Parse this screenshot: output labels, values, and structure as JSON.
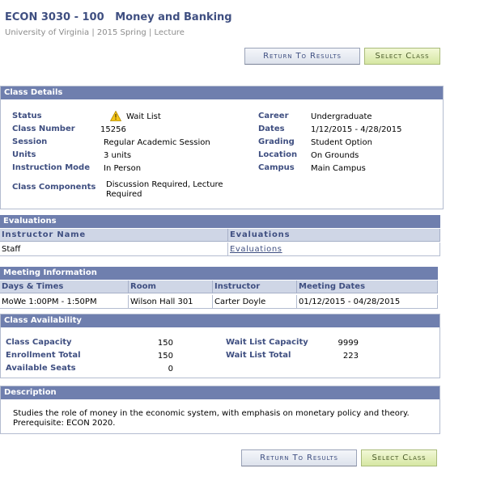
{
  "header": {
    "title": "ECON 3030 - 100   Money and Banking",
    "subtitle": "University of Virginia | 2015 Spring | Lecture"
  },
  "buttons": {
    "return_label": "Return To Results",
    "select_label": "Select Class"
  },
  "class_details": {
    "heading": "Class Details",
    "status_label": "Status",
    "status_value": "Wait List",
    "class_number_label": "Class Number",
    "class_number_value": "15256",
    "session_label": "Session",
    "session_value": "Regular Academic Session",
    "units_label": "Units",
    "units_value": "3 units",
    "instruction_mode_label": "Instruction Mode",
    "instruction_mode_value": "In Person",
    "components_label": "Class Components",
    "components_value_1": "Discussion Required, Lecture",
    "components_value_2": "Required",
    "career_label": "Career",
    "career_value": "Undergraduate",
    "dates_label": "Dates",
    "dates_value": "1/12/2015 - 4/28/2015",
    "grading_label": "Grading",
    "grading_value": "Student Option",
    "location_label": "Location",
    "location_value": "On Grounds",
    "campus_label": "Campus",
    "campus_value": "Main Campus",
    "status_icon": "warning-triangle-icon"
  },
  "evaluations": {
    "heading": "Evaluations",
    "columns": [
      "Instructor Name",
      "Evaluations"
    ],
    "row": {
      "instructor": "Staff",
      "link": "Evaluations"
    }
  },
  "meeting": {
    "heading": "Meeting Information",
    "columns": [
      "Days & Times",
      "Room",
      "Instructor",
      "Meeting Dates"
    ],
    "row": [
      "MoWe 1:00PM - 1:50PM",
      "Wilson Hall 301",
      "Carter Doyle",
      "01/12/2015 - 04/28/2015"
    ]
  },
  "availability": {
    "heading": "Class Availability",
    "capacity_label": "Class Capacity",
    "capacity_value": "150",
    "enrollment_label": "Enrollment Total",
    "enrollment_value": "150",
    "seats_label": "Available Seats",
    "seats_value": "0",
    "wl_capacity_label": "Wait List Capacity",
    "wl_capacity_value": "9999",
    "wl_total_label": "Wait List Total",
    "wl_total_value": "223"
  },
  "description": {
    "heading": "Description",
    "line1": "Studies the role of money in the economic system, with emphasis on monetary policy and theory.",
    "line2": "Prerequisite: ECON 2020."
  },
  "colors": {
    "header_bar": "#6f7fae",
    "label_blue": "#3f4f81",
    "warning": "#f5c518"
  }
}
